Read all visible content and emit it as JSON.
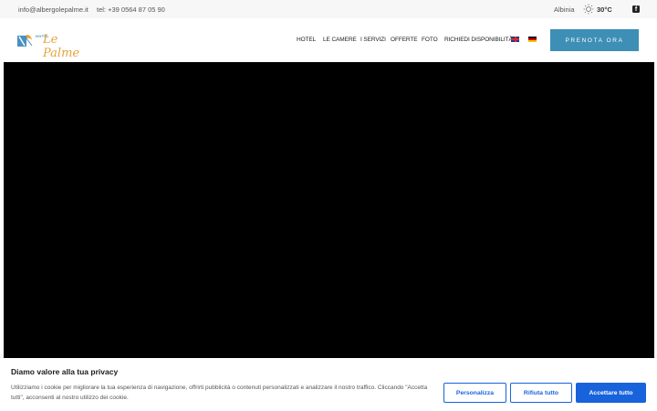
{
  "topbar": {
    "email": "info@albergolepalme.it",
    "phone": "tel: +39 0564 87 05 90",
    "city": "Albinia",
    "temperature": "30°C",
    "weather_icon": "sun-icon",
    "social_icon": "facebook-icon",
    "social_glyph": "f"
  },
  "logo": {
    "small_text": "HOTEL",
    "script_text": "Le Palme"
  },
  "nav": {
    "items": [
      "HOTEL",
      "LE CAMERE",
      "I SERVIZI",
      "OFFERTE",
      "FOTO",
      "RICHIEDI DISPONIBILITÀ"
    ],
    "languages": [
      "english-flag-icon",
      "german-flag-icon"
    ]
  },
  "book_button": "PRENOTA ORA",
  "cookie": {
    "title": "Diamo valore alla tua privacy",
    "text": "Utilizziamo i cookie per migliorare la tua esperienza di navigazione, offrirti pubblicità o contenuti personalizzati e analizzare il nostro traffico. Cliccando \"Accetta tutti\", acconsenti al nostro utilizzo dei cookie.",
    "customize": "Personalizza",
    "reject": "Rifiuta tutto",
    "accept": "Accettare tutto"
  },
  "colors": {
    "accent": "#3d8fb6",
    "cookie_blue": "#1863dc",
    "logo_orange": "#e6a23c"
  }
}
